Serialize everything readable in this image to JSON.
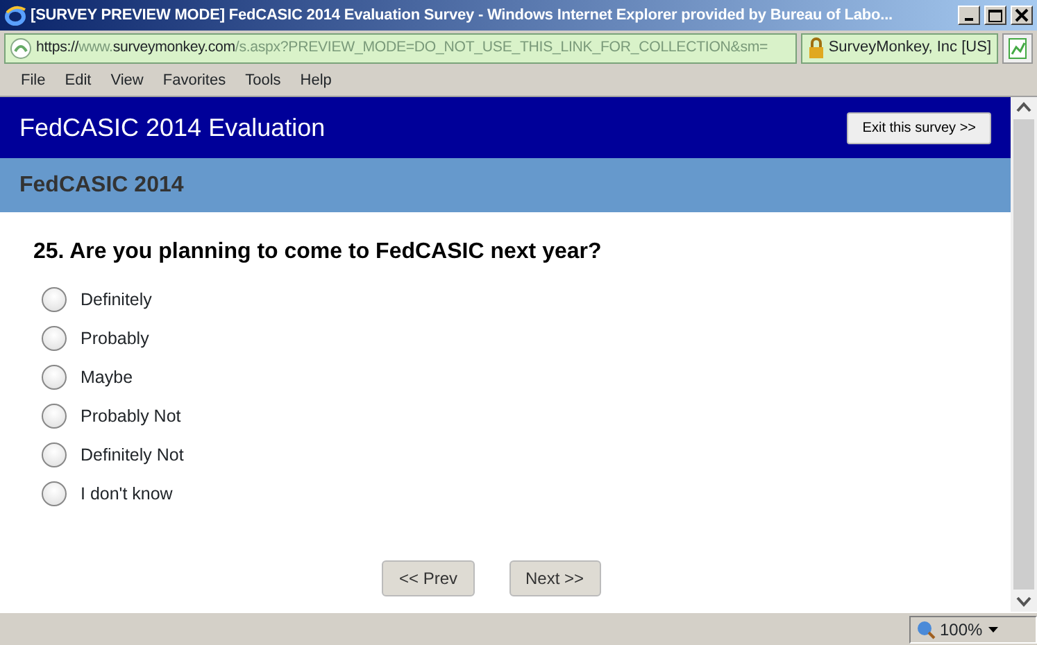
{
  "window": {
    "title": "[SURVEY PREVIEW MODE] FedCASIC 2014 Evaluation Survey - Windows Internet Explorer provided by Bureau of Labo..."
  },
  "address_bar": {
    "url": [
      {
        "text": "https://",
        "dim": false
      },
      {
        "text": "www.",
        "dim": true
      },
      {
        "text": "surveymonkey.com",
        "dim": false
      },
      {
        "text": "/s.aspx?PREVIEW_MODE=DO_NOT_USE_THIS_LINK_FOR_COLLECTION&sm=",
        "dim": true
      }
    ],
    "certificate": "SurveyMonkey, Inc [US]"
  },
  "menu": [
    "File",
    "Edit",
    "View",
    "Favorites",
    "Tools",
    "Help"
  ],
  "survey": {
    "title": "FedCASIC 2014 Evaluation",
    "exit_button": "Exit this survey >>",
    "page_title": "FedCASIC 2014",
    "question": "25. Are you planning to come to FedCASIC next year?",
    "options": [
      {
        "label": "Definitely",
        "selected": false
      },
      {
        "label": "Probably",
        "selected": false
      },
      {
        "label": "Maybe",
        "selected": false
      },
      {
        "label": "Probably Not",
        "selected": false
      },
      {
        "label": "Definitely Not",
        "selected": false
      },
      {
        "label": "I don't know",
        "selected": false
      }
    ],
    "buttons": [
      "<< Prev",
      "Next >>"
    ]
  },
  "status_bar": {
    "zoom": "100%"
  }
}
